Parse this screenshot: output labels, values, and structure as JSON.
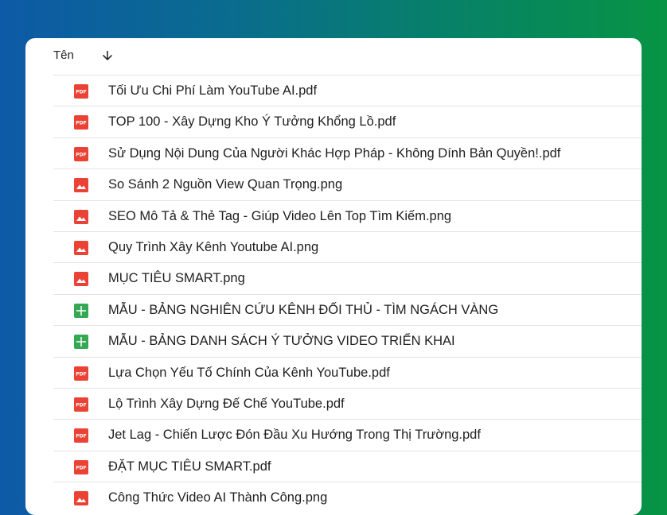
{
  "header": {
    "name_column_label": "Tên",
    "sort_icon": "arrow-down-icon"
  },
  "icon_colors": {
    "pdf": "#ea4335",
    "image": "#ea4335",
    "sheet": "#34a853"
  },
  "files": [
    {
      "name": "Tối Ưu Chi Phí Làm YouTube AI.pdf",
      "type": "pdf"
    },
    {
      "name": "TOP 100 - Xây Dựng Kho Ý Tưởng Khổng Lồ.pdf",
      "type": "pdf"
    },
    {
      "name": "Sử Dụng Nội Dung Của Người Khác Hợp Pháp - Không Dính Bản Quyền!.pdf",
      "type": "pdf"
    },
    {
      "name": "So Sánh 2 Nguồn View Quan Trọng.png",
      "type": "image"
    },
    {
      "name": "SEO Mô Tả & Thẻ Tag - Giúp Video Lên Top Tìm Kiếm.png",
      "type": "image"
    },
    {
      "name": "Quy Trình Xây Kênh Youtube AI.png",
      "type": "image"
    },
    {
      "name": "MỤC TIÊU SMART.png",
      "type": "image"
    },
    {
      "name": "MẪU - BẢNG NGHIÊN CỨU KÊNH ĐỐI THỦ - TÌM NGÁCH VÀNG",
      "type": "sheet"
    },
    {
      "name": "MẪU - BẢNG DANH SÁCH Ý TƯỞNG VIDEO TRIỂN KHAI",
      "type": "sheet"
    },
    {
      "name": "Lựa Chọn Yếu Tố Chính Của Kênh YouTube.pdf",
      "type": "pdf"
    },
    {
      "name": "Lộ Trình Xây Dựng Đế Chế YouTube.pdf",
      "type": "pdf"
    },
    {
      "name": "Jet Lag - Chiến Lược Đón Đầu Xu Hướng Trong Thị Trường.pdf",
      "type": "pdf"
    },
    {
      "name": "ĐẶT MỤC TIÊU SMART.pdf",
      "type": "pdf"
    },
    {
      "name": "Công Thức Video AI Thành Công.png",
      "type": "image"
    }
  ]
}
